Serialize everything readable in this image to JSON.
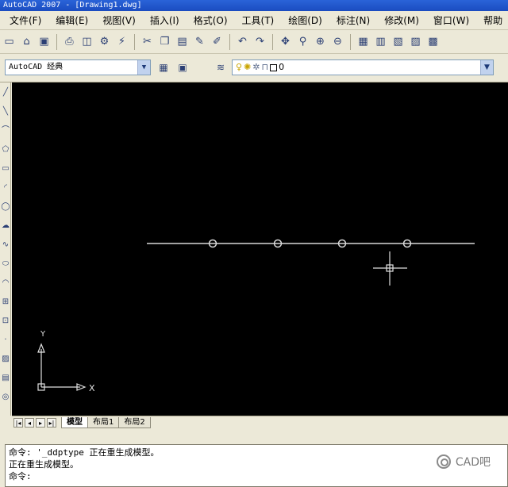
{
  "window": {
    "title": "AutoCAD 2007 - [Drawing1.dwg]"
  },
  "menu": [
    "文件(F)",
    "编辑(E)",
    "视图(V)",
    "插入(I)",
    "格式(O)",
    "工具(T)",
    "绘图(D)",
    "标注(N)",
    "修改(M)",
    "窗口(W)",
    "帮助"
  ],
  "toolbar_standard": {
    "icons": [
      "new-icon",
      "open-icon",
      "save-icon",
      "plot-icon",
      "plot-preview-icon",
      "publish-icon",
      "properties-icon",
      "cut-icon",
      "copy-icon",
      "paste-icon",
      "match-properties-icon",
      "brush-icon",
      "undo-icon",
      "redo-icon",
      "pan-icon",
      "zoom-realtime-icon",
      "zoom-window-icon",
      "zoom-previous-icon",
      "properties-palette-icon",
      "design-center-icon",
      "tool-palettes-icon",
      "sheet-set-icon",
      "calculator-icon"
    ]
  },
  "workspace": {
    "selected": "AutoCAD 经典"
  },
  "layer": {
    "selected": "0"
  },
  "left_toolbar": {
    "icons": [
      "line-icon",
      "construction-line-icon",
      "polyline-icon",
      "polygon-icon",
      "rectangle-icon",
      "arc-icon",
      "circle-icon",
      "revcloud-icon",
      "spline-icon",
      "ellipse-icon",
      "ellipse-arc-icon",
      "insert-block-icon",
      "make-block-icon",
      "point-icon",
      "hatch-icon",
      "gradient-icon",
      "region-icon",
      "table-icon",
      "mtext-icon"
    ]
  },
  "ucs": {
    "x_label": "X",
    "y_label": "Y"
  },
  "tabs": [
    "模型",
    "布局1",
    "布局2"
  ],
  "command": {
    "lines": [
      "命令: '_ddptype 正在重生成模型。",
      "正在重生成模型。",
      "命令:"
    ]
  },
  "watermark": {
    "text": "CAD吧"
  },
  "colors": {
    "canvas": "#000000",
    "line": "#d8d8d8",
    "ucs": "#e0e0e0"
  }
}
